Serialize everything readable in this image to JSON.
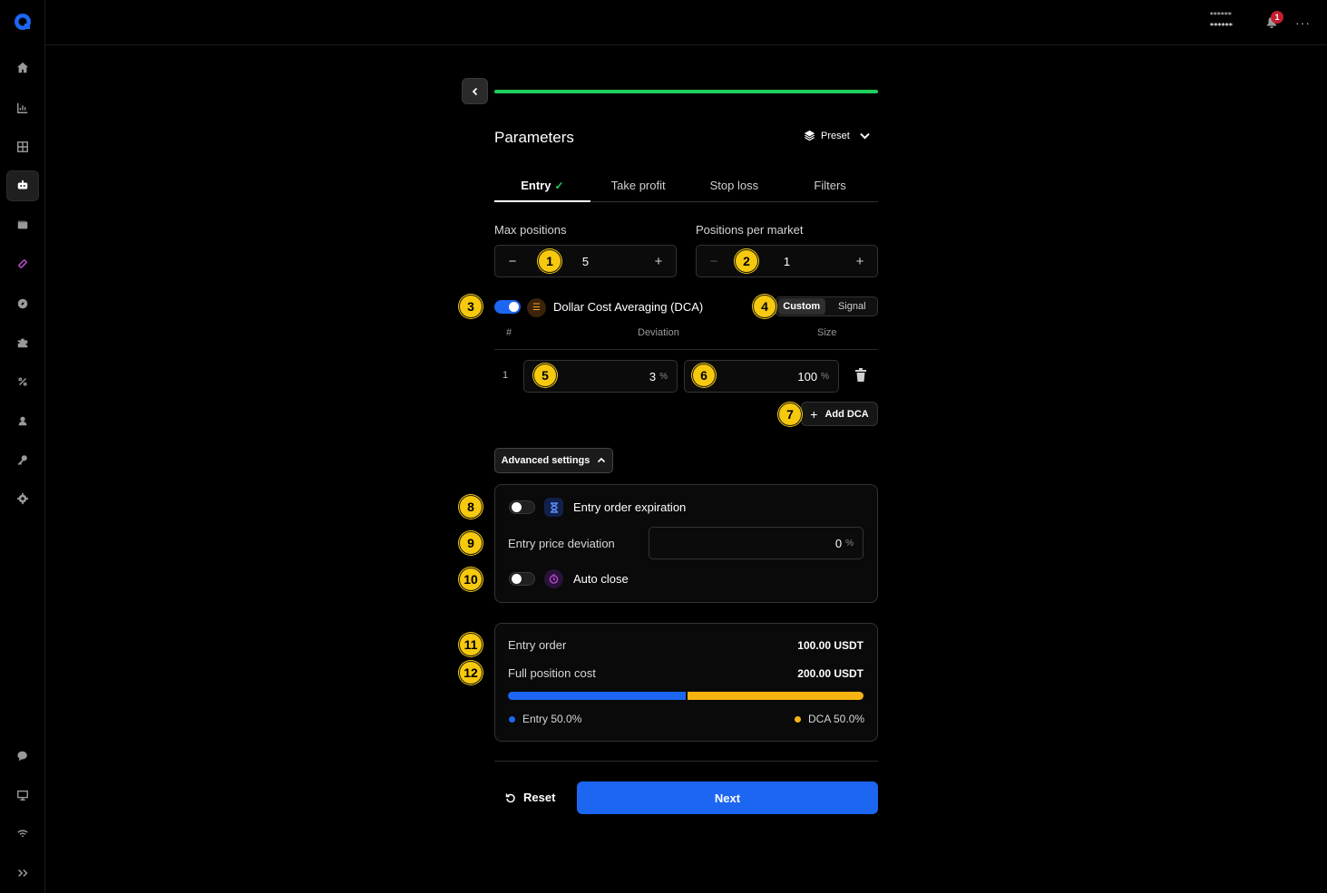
{
  "topbar": {
    "masked_line1": "******",
    "masked_line2": "******",
    "notification_count": "1",
    "more": "···"
  },
  "sidebar": {
    "items": [
      {
        "icon": "home-icon"
      },
      {
        "icon": "chart-icon"
      },
      {
        "icon": "grid-icon"
      },
      {
        "icon": "bot-icon",
        "active": true
      },
      {
        "icon": "wallet-icon"
      },
      {
        "icon": "signal-icon"
      },
      {
        "icon": "compass-icon"
      },
      {
        "icon": "puzzle-icon"
      },
      {
        "icon": "percent-icon"
      },
      {
        "icon": "user-icon"
      },
      {
        "icon": "key-icon"
      },
      {
        "icon": "gear-icon"
      }
    ],
    "bottom": [
      {
        "icon": "chat-icon"
      },
      {
        "icon": "monitor-icon"
      },
      {
        "icon": "wifi-icon"
      },
      {
        "icon": "expand-icon"
      }
    ]
  },
  "header": {
    "title": "Parameters",
    "preset_label": "Preset",
    "progress": 1.0
  },
  "tabs": [
    {
      "label": "Entry",
      "active": true,
      "completed": true
    },
    {
      "label": "Take profit"
    },
    {
      "label": "Stop loss"
    },
    {
      "label": "Filters"
    }
  ],
  "max_positions": {
    "label": "Max positions",
    "value": "5",
    "minus": "−",
    "plus": "+"
  },
  "positions_per_market": {
    "label": "Positions per market",
    "value": "1",
    "minus": "−",
    "plus": "+"
  },
  "dca": {
    "title": "Dollar Cost Averaging (DCA)",
    "enabled": true,
    "mode_options": [
      "Custom",
      "Signal"
    ],
    "mode_selected": "Custom",
    "columns": [
      "#",
      "Deviation",
      "Size"
    ],
    "rows": [
      {
        "index": "1",
        "deviation": "3",
        "size": "100",
        "unit": "%"
      }
    ],
    "add_label": "Add DCA"
  },
  "advanced": {
    "button_label": "Advanced settings",
    "expiration_label": "Entry order expiration",
    "expiration_enabled": false,
    "price_deviation_label": "Entry price deviation",
    "price_deviation_value": "0",
    "price_deviation_unit": "%",
    "auto_close_label": "Auto close",
    "auto_close_enabled": false
  },
  "summary": {
    "entry_order_label": "Entry order",
    "entry_order_value": "100.00 USDT",
    "full_cost_label": "Full position cost",
    "full_cost_value": "200.00 USDT",
    "entry_share": 0.5,
    "dca_share": 0.5,
    "entry_legend": "Entry 50.0%",
    "dca_legend": "DCA 50.0%",
    "colors": {
      "entry": "#1c66f2",
      "dca": "#f5b412"
    }
  },
  "footer": {
    "reset_label": "Reset",
    "next_label": "Next"
  },
  "markers": [
    "1",
    "2",
    "3",
    "4",
    "5",
    "6",
    "7",
    "8",
    "9",
    "10",
    "11",
    "12"
  ]
}
